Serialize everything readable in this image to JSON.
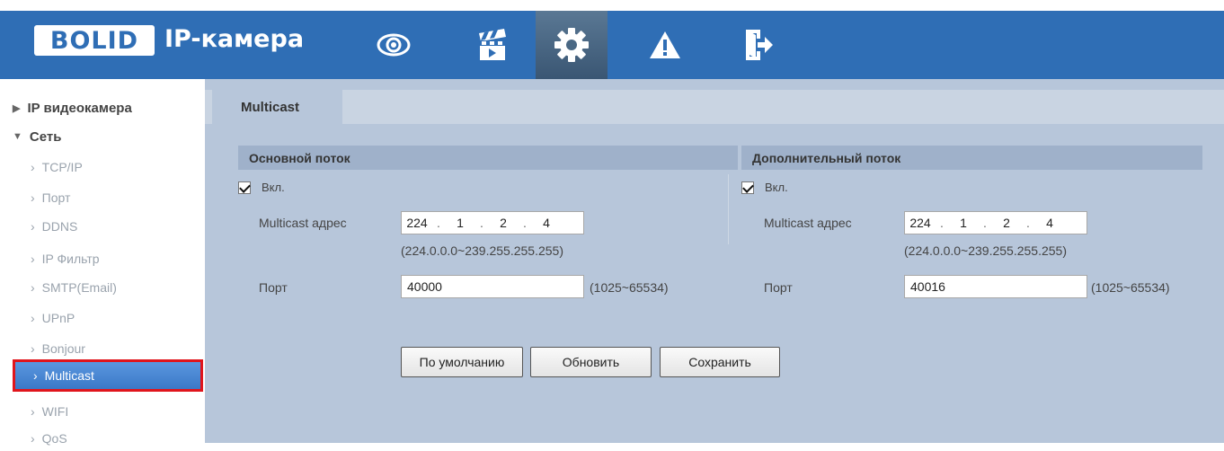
{
  "header": {
    "logo_text": "BOLID",
    "app_title": "IP-камера",
    "nav": [
      {
        "icon": "eye-icon"
      },
      {
        "icon": "clapperboard-icon"
      },
      {
        "icon": "gear-icon",
        "active": true
      },
      {
        "icon": "warning-icon"
      },
      {
        "icon": "logout-icon"
      }
    ]
  },
  "sidebar": {
    "groups": [
      {
        "label": "IP видеокамера",
        "expanded": false
      },
      {
        "label": "Сеть",
        "expanded": true
      }
    ],
    "items": [
      {
        "label": "TCP/IP"
      },
      {
        "label": "Порт"
      },
      {
        "label": "DDNS"
      },
      {
        "label": "IP Фильтр"
      },
      {
        "label": "SMTP(Email)"
      },
      {
        "label": "UPnP"
      },
      {
        "label": "Bonjour"
      },
      {
        "label": "Multicast",
        "active": true
      },
      {
        "label": "WIFI"
      },
      {
        "label": "QoS"
      }
    ]
  },
  "main": {
    "tab": "Multicast",
    "primary": {
      "title": "Основной поток",
      "enable_label": "Вкл.",
      "enabled": true,
      "address_label": "Multicast адрес",
      "address": [
        "224",
        "1",
        "2",
        "4"
      ],
      "address_hint": "(224.0.0.0~239.255.255.255)",
      "port_label": "Порт",
      "port": "40000",
      "port_hint": "(1025~65534)"
    },
    "secondary": {
      "title": "Дополнительный поток",
      "enable_label": "Вкл.",
      "enabled": true,
      "address_label": "Multicast адрес",
      "address": [
        "224",
        "1",
        "2",
        "4"
      ],
      "address_hint": "(224.0.0.0~239.255.255.255)",
      "port_label": "Порт",
      "port": "40016",
      "port_hint": "(1025~65534)"
    },
    "buttons": {
      "default": "По умолчанию",
      "refresh": "Обновить",
      "save": "Сохранить"
    }
  },
  "colors": {
    "header_bg": "#2f6eb5",
    "content_bg": "#b7c6da",
    "section_head_bg": "#9fb1ca",
    "active_item_bg": "#3a78c7",
    "highlight_border": "#e0151c"
  }
}
